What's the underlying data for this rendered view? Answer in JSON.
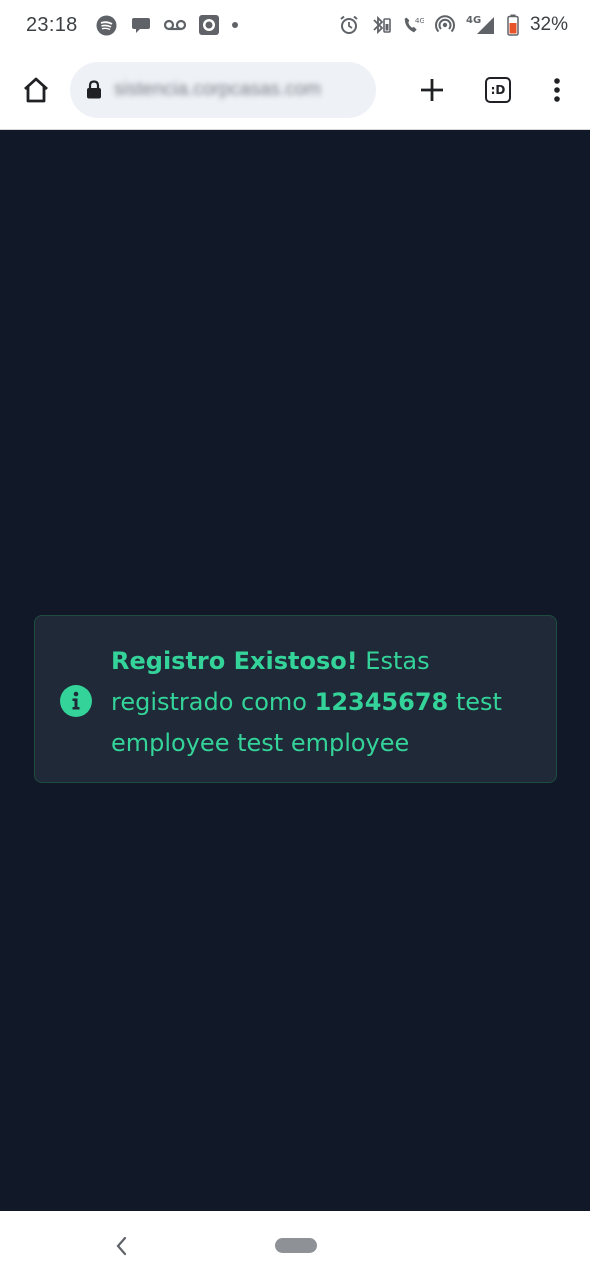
{
  "status_bar": {
    "time": "23:18",
    "battery_percent": "32%",
    "network_label_1": "4G",
    "network_label_2": "4G",
    "icons_left": [
      "spotify-icon",
      "chat-bubble-icon",
      "voicemail-icon",
      "media-icon",
      "dot"
    ],
    "icons_right": [
      "alarm-icon",
      "bluetooth-icon",
      "wifi-call-icon",
      "hotspot-icon",
      "signal-icon",
      "battery-icon"
    ]
  },
  "toolbar": {
    "url": "sistencia.corpcasas.com",
    "tab_count_label": ":D"
  },
  "alert": {
    "title": "Registro Existoso!",
    "text_before_id": " Estas registrado como ",
    "user_id": "12345678",
    "text_after_id": " test employee test employee",
    "accent_color": "#34d399",
    "background_color": "#1f2937"
  },
  "page": {
    "background_color": "#111827"
  }
}
